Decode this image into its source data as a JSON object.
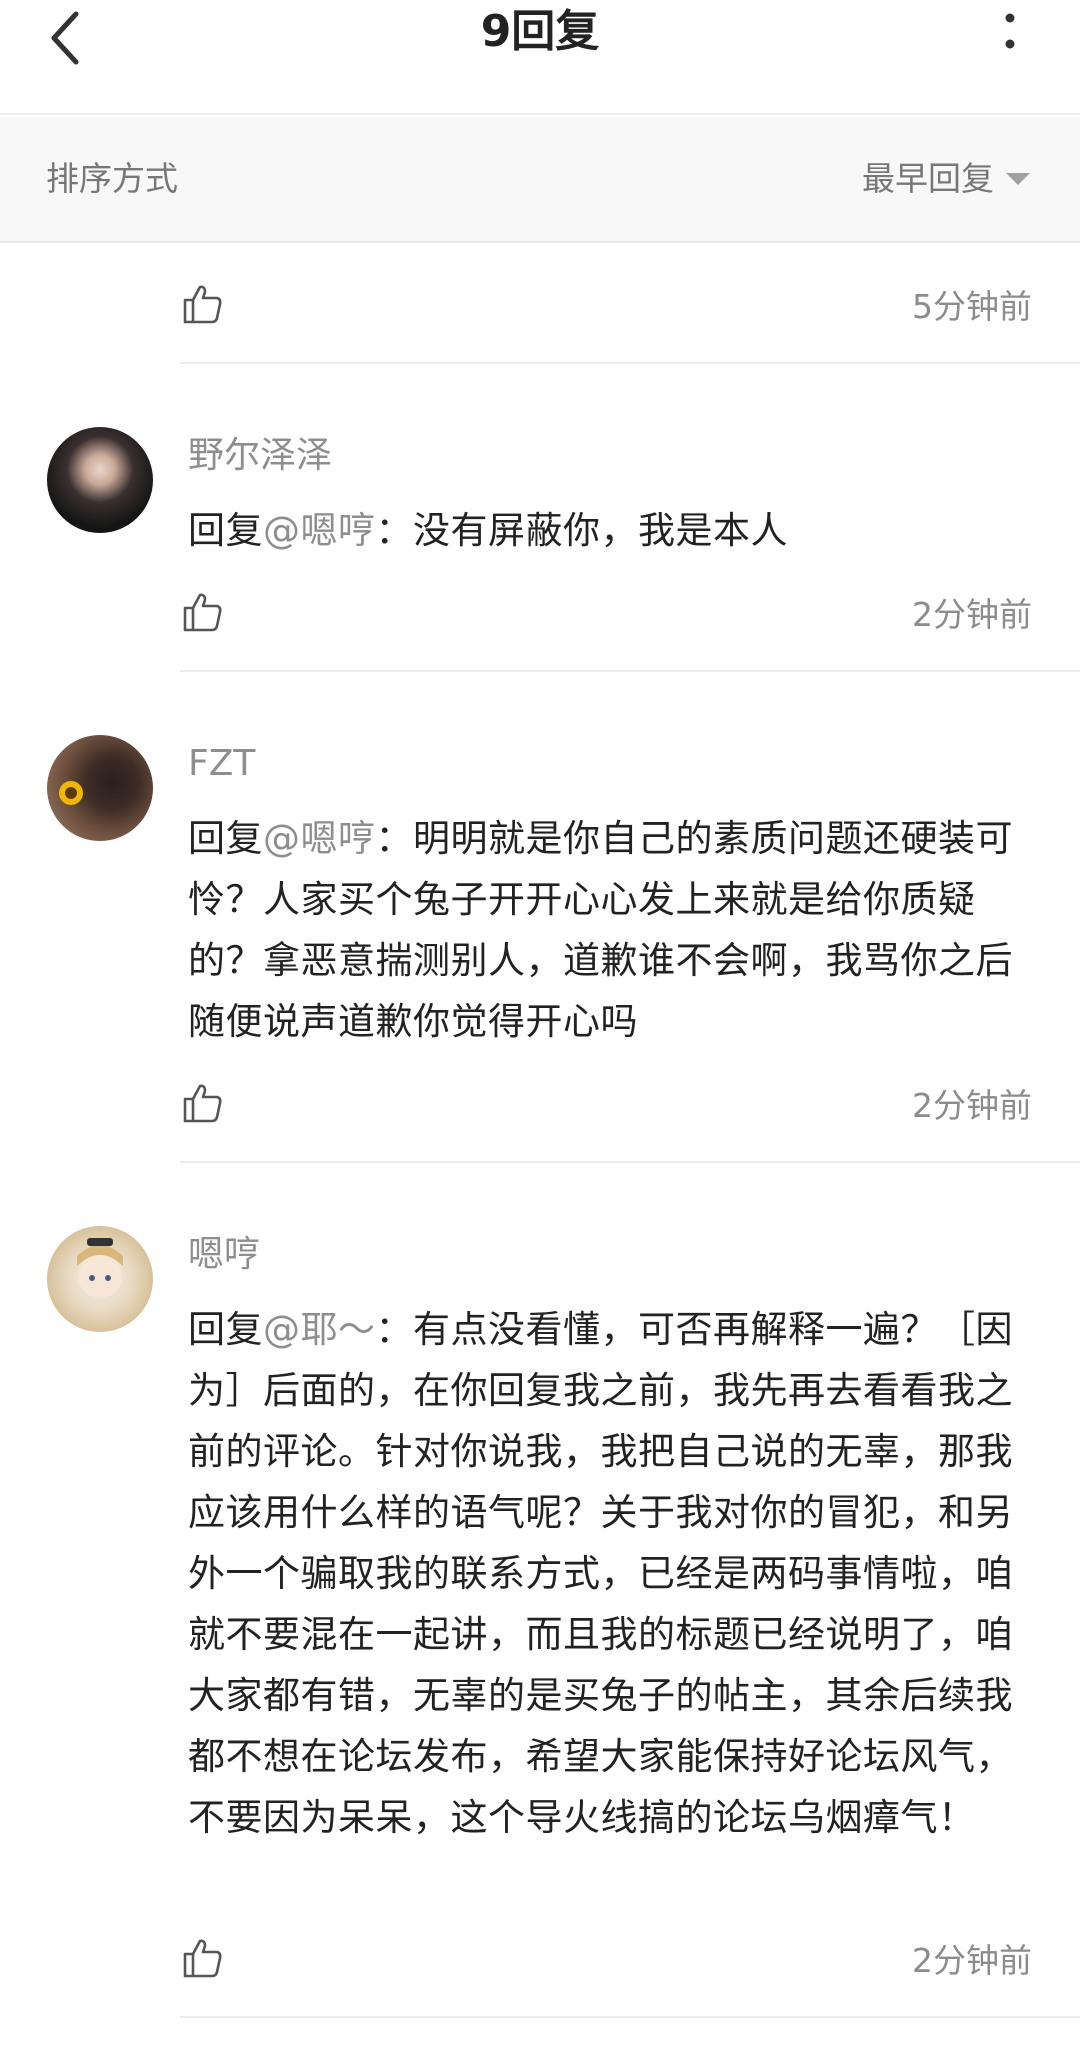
{
  "header": {
    "title": "9回复"
  },
  "sort": {
    "label": "排序方式",
    "value": "最早回复"
  },
  "comments": [
    {
      "time": "5分钟前"
    },
    {
      "username": "野尔泽泽",
      "reply_prefix": "回复",
      "mention": "@嗯哼",
      "separator": "：",
      "text": "没有屏蔽你，我是本人",
      "time": "2分钟前"
    },
    {
      "username": "FZT",
      "reply_prefix": "回复",
      "mention": "@嗯哼",
      "separator": "：",
      "text": "明明就是你自己的素质问题还硬装可怜？人家买个兔子开开心心发上来就是给你质疑的？拿恶意揣测别人，道歉谁不会啊，我骂你之后随便说声道歉你觉得开心吗",
      "time": "2分钟前"
    },
    {
      "username": "嗯哼",
      "reply_prefix": "回复",
      "mention": "@耶～",
      "separator": "：",
      "text": "有点没看懂，可否再解释一遍？［因为］后面的，在你回复我之前，我先再去看看我之前的评论。针对你说我，我把自己说的无辜，那我应该用什么样的语气呢？关于我对你的冒犯，和另外一个骗取我的联系方式，已经是两码事情啦，咱就不要混在一起讲，而且我的标题已经说明了，咱大家都有错，无辜的是买兔子的帖主，其余后续我都不想在论坛发布，希望大家能保持好论坛风气，不要因为呆呆，这个导火线搞的论坛乌烟瘴气！",
      "time": "2分钟前"
    }
  ]
}
